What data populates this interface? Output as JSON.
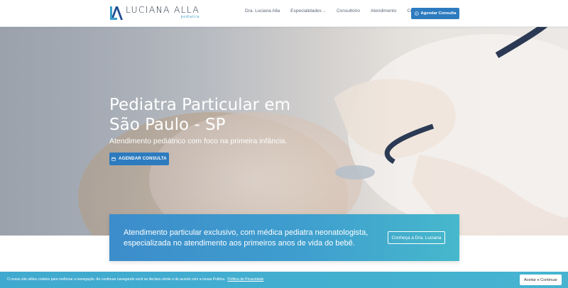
{
  "brand": {
    "name": "LUCIANA ALLA",
    "tagline": "pediatria",
    "logo_icon": "la-monogram-icon",
    "colors": {
      "primary": "#2d7bbf",
      "accent": "#3aa0c8",
      "teal": "#46b8cc"
    }
  },
  "nav": {
    "items": [
      {
        "label": "Dra. Luciana Alla"
      },
      {
        "label": "Especialidades",
        "has_dropdown": true
      },
      {
        "label": "Consultório"
      },
      {
        "label": "Atendimento"
      },
      {
        "label": "Contato"
      }
    ],
    "cta_label": "Agendar Consulta",
    "cta_icon": "whatsapp-icon"
  },
  "hero": {
    "title": "Pediatra Particular em São Paulo - SP",
    "subtitle": "Atendimento pediátrico com foco na primeira infância.",
    "button_label": "AGENDAR CONSULTA",
    "button_icon": "calendar-icon"
  },
  "band": {
    "text": "Atendimento particular exclusivo, com médica pediatra neonatologista, especializada no atendimento aos primeiros anos de vida do bebê.",
    "button_label": "Conheça a Dra. Luciana"
  },
  "cookie": {
    "text": "O nosso site utiliza cookies para melhorar a navegação. Ao continuar navegando você se declara ciente e de acordo com a nossa Política.",
    "link_label": "Política de Privacidade",
    "button_label": "Aceitar e Continuar"
  }
}
